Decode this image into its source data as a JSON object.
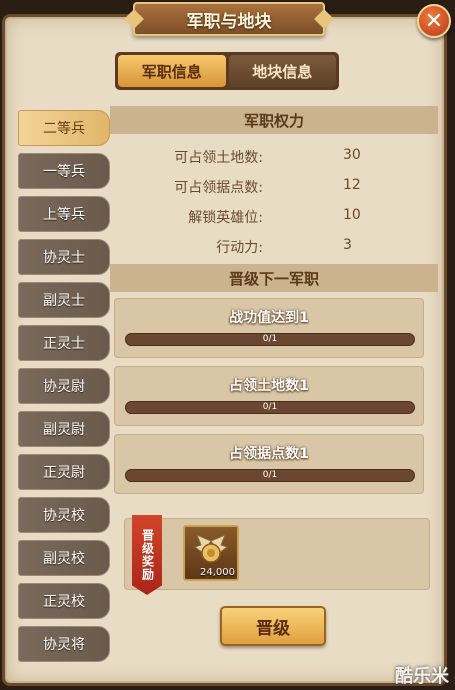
{
  "window": {
    "title": "军职与地块",
    "close_symbol": "✕"
  },
  "tabs": [
    {
      "label": "军职信息",
      "active": true
    },
    {
      "label": "地块信息",
      "active": false
    }
  ],
  "sidebar": {
    "items": [
      {
        "label": "二等兵",
        "active": true
      },
      {
        "label": "一等兵",
        "active": false
      },
      {
        "label": "上等兵",
        "active": false
      },
      {
        "label": "协灵士",
        "active": false
      },
      {
        "label": "副灵士",
        "active": false
      },
      {
        "label": "正灵士",
        "active": false
      },
      {
        "label": "协灵尉",
        "active": false
      },
      {
        "label": "副灵尉",
        "active": false
      },
      {
        "label": "正灵尉",
        "active": false
      },
      {
        "label": "协灵校",
        "active": false
      },
      {
        "label": "副灵校",
        "active": false
      },
      {
        "label": "正灵校",
        "active": false
      },
      {
        "label": "协灵将",
        "active": false
      }
    ]
  },
  "power": {
    "header": "军职权力",
    "rows": [
      {
        "label": "可占领土地数:",
        "value": "30"
      },
      {
        "label": "可占领据点数:",
        "value": "12"
      },
      {
        "label": "解锁英雄位:",
        "value": "10"
      },
      {
        "label": "行动力:",
        "value": "3"
      }
    ]
  },
  "next_rank": {
    "header": "晋级下一军职",
    "tasks": [
      {
        "title": "战功值达到1",
        "progress_text": "0/1",
        "progress": 0
      },
      {
        "title": "占领土地数1",
        "progress_text": "0/1",
        "progress": 0
      },
      {
        "title": "占领据点数1",
        "progress_text": "0/1",
        "progress": 0
      }
    ]
  },
  "reward": {
    "ribbon_label": "晋级奖励",
    "item_icon": "winged-medal-icon",
    "item_count": "24,000"
  },
  "upgrade_button": {
    "label": "晋级"
  },
  "watermark": "酷乐米",
  "colors": {
    "accent": "#e0a040",
    "panel": "#e9dcc4",
    "active_tab": "#f6c86b"
  }
}
